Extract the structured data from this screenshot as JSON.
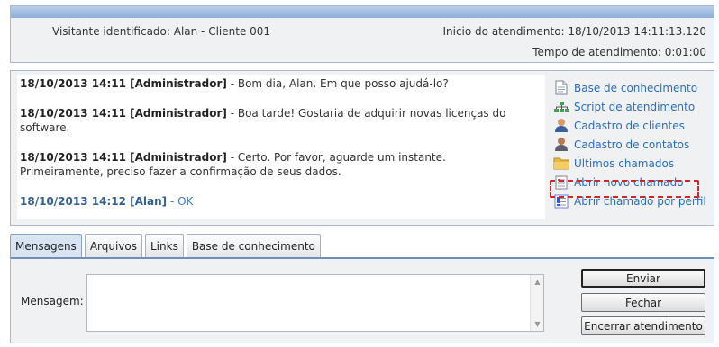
{
  "header": {
    "visitor": "Visitante identificado: Alan - Cliente 001",
    "start_time": "Inicio do atendimento: 18/10/2013 14:11:13.120",
    "duration": "Tempo de atendimento: 0:01:00"
  },
  "chat": {
    "messages": [
      {
        "meta": "18/10/2013 14:11 [Administrador]",
        "text": " - Bom dia, Alan. Em que posso ajudá-lo?"
      },
      {
        "meta": "18/10/2013 14:11 [Administrador]",
        "text": " - Boa tarde! Gostaria de adquirir novas licenças do software."
      },
      {
        "meta": "18/10/2013 14:11 [Administrador]",
        "text": " - Certo. Por favor, aguarde um instante.",
        "text2": "Primeiramente, preciso fazer a confirmação de seus dados."
      },
      {
        "meta": "18/10/2013 14:12 [Alan]",
        "text": " - OK"
      }
    ]
  },
  "side_links": [
    {
      "label": "Base de conhecimento",
      "icon": "document-icon"
    },
    {
      "label": "Script de atendimento",
      "icon": "sitemap-icon"
    },
    {
      "label": "Cadastro de clientes",
      "icon": "user-icon"
    },
    {
      "label": "Cadastro de contatos",
      "icon": "contact-icon"
    },
    {
      "label": "Últimos chamados",
      "icon": "folder-icon"
    },
    {
      "label": "Abrir novo chamado",
      "icon": "form-icon"
    },
    {
      "label": "Abrir chamado por perfil",
      "icon": "list-icon"
    }
  ],
  "tabs": [
    "Mensagens",
    "Arquivos",
    "Links",
    "Base de conhecimento"
  ],
  "form": {
    "message_label": "Mensagem:",
    "message_value": "",
    "send": "Enviar",
    "close": "Fechar",
    "end": "Encerrar atendimento"
  },
  "colors": {
    "link": "#2a6ebf",
    "highlight": "#d02626",
    "alan": "#3d7ac2"
  }
}
